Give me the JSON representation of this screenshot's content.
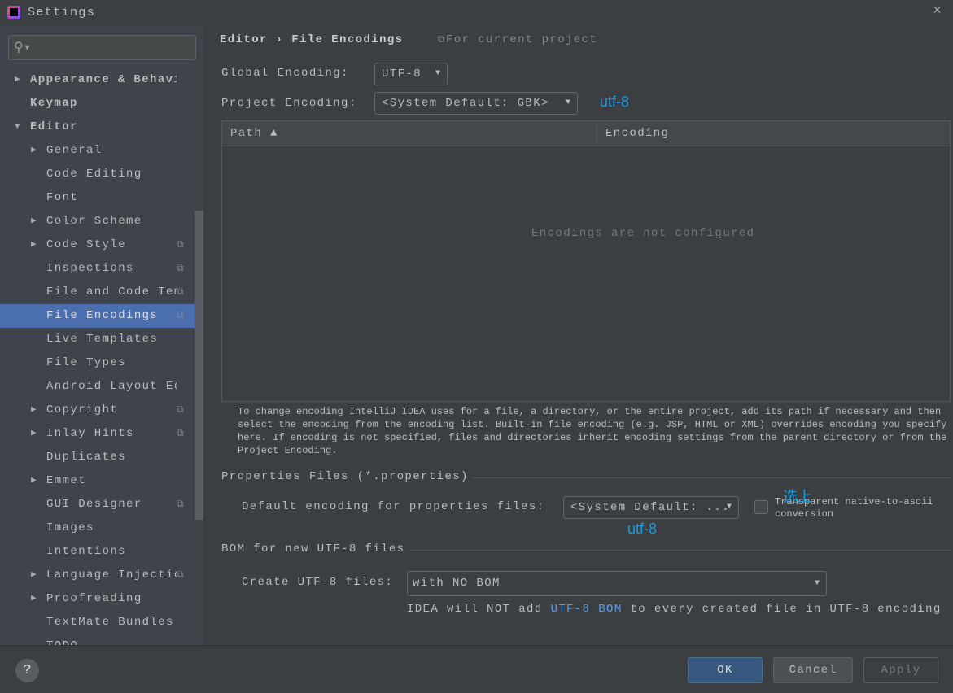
{
  "window": {
    "title": "Settings",
    "close_icon": "×"
  },
  "sidebar": {
    "search_placeholder": "",
    "items": [
      {
        "label": "Appearance & Behavior",
        "level": 0,
        "arrow": "right"
      },
      {
        "label": "Keymap",
        "level": 0,
        "arrow": ""
      },
      {
        "label": "Editor",
        "level": 0,
        "arrow": "down"
      },
      {
        "label": "General",
        "level": 1,
        "arrow": "right"
      },
      {
        "label": "Code Editing",
        "level": 1,
        "arrow": ""
      },
      {
        "label": "Font",
        "level": 1,
        "arrow": ""
      },
      {
        "label": "Color Scheme",
        "level": 1,
        "arrow": "right"
      },
      {
        "label": "Code Style",
        "level": 1,
        "arrow": "right",
        "project": true
      },
      {
        "label": "Inspections",
        "level": 1,
        "arrow": "",
        "project": true
      },
      {
        "label": "File and Code Templates",
        "level": 1,
        "arrow": "",
        "project": true
      },
      {
        "label": "File Encodings",
        "level": 1,
        "arrow": "",
        "project": true,
        "selected": true
      },
      {
        "label": "Live Templates",
        "level": 1,
        "arrow": ""
      },
      {
        "label": "File Types",
        "level": 1,
        "arrow": ""
      },
      {
        "label": "Android Layout Editor",
        "level": 1,
        "arrow": ""
      },
      {
        "label": "Copyright",
        "level": 1,
        "arrow": "right",
        "project": true
      },
      {
        "label": "Inlay Hints",
        "level": 1,
        "arrow": "right",
        "project": true
      },
      {
        "label": "Duplicates",
        "level": 1,
        "arrow": ""
      },
      {
        "label": "Emmet",
        "level": 1,
        "arrow": "right"
      },
      {
        "label": "GUI Designer",
        "level": 1,
        "arrow": "",
        "project": true
      },
      {
        "label": "Images",
        "level": 1,
        "arrow": ""
      },
      {
        "label": "Intentions",
        "level": 1,
        "arrow": ""
      },
      {
        "label": "Language Injections",
        "level": 1,
        "arrow": "right",
        "project": true
      },
      {
        "label": "Proofreading",
        "level": 1,
        "arrow": "right"
      },
      {
        "label": "TextMate Bundles",
        "level": 1,
        "arrow": ""
      },
      {
        "label": "TODO",
        "level": 1,
        "arrow": ""
      }
    ]
  },
  "main": {
    "breadcrumb": {
      "parent": "Editor",
      "sep": "›",
      "current": "File Encodings"
    },
    "scope": "For current project",
    "global_label": "Global Encoding:",
    "global_value": "UTF-8",
    "project_label": "Project Encoding:",
    "project_value": "<System Default: GBK>",
    "annotation_project": "utf-8",
    "table": {
      "columns": [
        "Path ▲",
        "Encoding"
      ],
      "empty_text": "Encodings are not configured"
    },
    "help_lines": [
      "To change encoding IntelliJ IDEA uses for a file, a directory, or the entire project, add its path if necessary and then select the",
      "encoding from the encoding list. Built-in file encoding (e.g. JSP, HTML or XML) overrides encoding you specify here. If encoding is not",
      "specified, files and directories inherit encoding settings from the parent directory or from the Project Encoding."
    ],
    "properties_title": "Properties Files (*.properties)",
    "properties_label": "Default encoding for properties files:",
    "properties_value": "<System Default: ...",
    "transparent_label": "Transparent native-to-ascii conversion",
    "transparent_checked": false,
    "annotation_check": "选上",
    "annotation_props": "utf-8",
    "bom_title": "BOM for new UTF-8 files",
    "bom_label": "Create UTF-8 files:",
    "bom_value": "with NO BOM",
    "bom_note_pre": "IDEA will NOT add ",
    "bom_note_link": "UTF-8 BOM",
    "bom_note_post": " to every created file in UTF-8 encoding"
  },
  "footer": {
    "help": "?",
    "ok": "OK",
    "cancel": "Cancel",
    "apply": "Apply"
  },
  "colors": {
    "accent": "#4b6eaf",
    "annotation": "#1e9ae0",
    "link": "#589df6"
  }
}
